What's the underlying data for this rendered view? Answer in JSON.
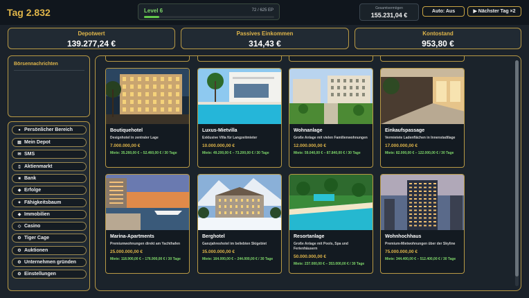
{
  "header": {
    "day": "Tag 2.832",
    "level": {
      "label": "Level 6",
      "xp_text": "72 / 625 EP",
      "progress": 0.115
    },
    "wealth": {
      "label": "Gesamtvermögen",
      "value": "155.231,04 €"
    },
    "auto_button": "Auto: Aus",
    "next_day_button": "▶ Nächster Tag ×2"
  },
  "stats": [
    {
      "label": "Depotwert",
      "value": "139.277,24 €"
    },
    {
      "label": "Passives Einkommen",
      "value": "314,43 €"
    },
    {
      "label": "Kontostand",
      "value": "953,80 €"
    }
  ],
  "news": {
    "title": "Börsennachrichten"
  },
  "nav": [
    {
      "label": "Persönlicher Bereich",
      "icon": "person-icon",
      "glyph": "●"
    },
    {
      "label": "Mein Depot",
      "icon": "briefcase-icon",
      "glyph": "▤"
    },
    {
      "label": "SMS",
      "icon": "message-icon",
      "glyph": "✉"
    },
    {
      "label": "Aktienmarkt",
      "icon": "chart-icon",
      "glyph": "▯"
    },
    {
      "label": "Bank",
      "icon": "bank-icon",
      "glyph": "■"
    },
    {
      "label": "Erfolge",
      "icon": "trophy-icon",
      "glyph": "◆"
    },
    {
      "label": "Fähigkeitsbaum",
      "icon": "skill-tree-icon",
      "glyph": "✦"
    },
    {
      "label": "Immobilien",
      "icon": "house-icon",
      "glyph": "◆"
    },
    {
      "label": "Casino",
      "icon": "casino-icon",
      "glyph": "◇"
    },
    {
      "label": "Tiger Cage",
      "icon": "tiger-icon",
      "glyph": "⚙"
    },
    {
      "label": "Auktionen",
      "icon": "gavel-icon",
      "glyph": "⚙"
    },
    {
      "label": "Unternehmen gründen",
      "icon": "company-icon",
      "glyph": "⚙"
    },
    {
      "label": "Einstellungen",
      "icon": "gear-icon",
      "glyph": "⚙"
    }
  ],
  "properties": [
    {
      "name": "Boutiquehotel",
      "desc": "Designhotel in zentraler Lage",
      "price": "7.000.000,00 €",
      "rent": "Miete: 35.260,00 € – 52.460,00 € / 30 Tage",
      "scene": "hotel-facade"
    },
    {
      "name": "Luxus-Mietvilla",
      "desc": "Exklusive Villa für Langzeitmieter",
      "price": "10.000.000,00 €",
      "rent": "Miete: 49.200,00 € – 73.200,00 € / 30 Tage",
      "scene": "villa-pool"
    },
    {
      "name": "Wohnanlage",
      "desc": "Große Anlage mit vielen Familienwohnungen",
      "price": "12.000.000,00 €",
      "rent": "Miete: 59.040,00 € – 87.840,00 € / 30 Tage",
      "scene": "apartment-complex"
    },
    {
      "name": "Einkaufspassage",
      "desc": "Vermietete Ladenflächen in Innenstadtlage",
      "price": "17.000.000,00 €",
      "rent": "Miete: 82.000,00 € – 122.000,00 € / 30 Tage",
      "scene": "shopping-arcade"
    },
    {
      "name": "Marina-Apartments",
      "desc": "Premiumwohnungen direkt am Yachthafen",
      "price": "25.000.000,00 €",
      "rent": "Miete: 118.900,00 € – 176.900,00 € / 30 Tage",
      "scene": "marina-sunset"
    },
    {
      "name": "Berghotel",
      "desc": "Ganzjahreshotel im beliebten Skigebiet",
      "price": "35.000.000,00 €",
      "rent": "Miete: 164.000,00 € – 244.000,00 € / 30 Tage",
      "scene": "mountain-hotel"
    },
    {
      "name": "Resortanlage",
      "desc": "Große Anlage mit Pools, Spa und Ferienhäusern",
      "price": "50.000.000,00 €",
      "rent": "Miete: 237.000,00 € – 353.000,00 € / 30 Tage",
      "scene": "beach-resort"
    },
    {
      "name": "Wohnhochhaus",
      "desc": "Premium-Mietwohnungen über der Skyline",
      "price": "75.000.000,00 €",
      "rent": "Miete: 344.400,00 € – 512.400,00 € / 30 Tage",
      "scene": "skyscraper"
    }
  ]
}
